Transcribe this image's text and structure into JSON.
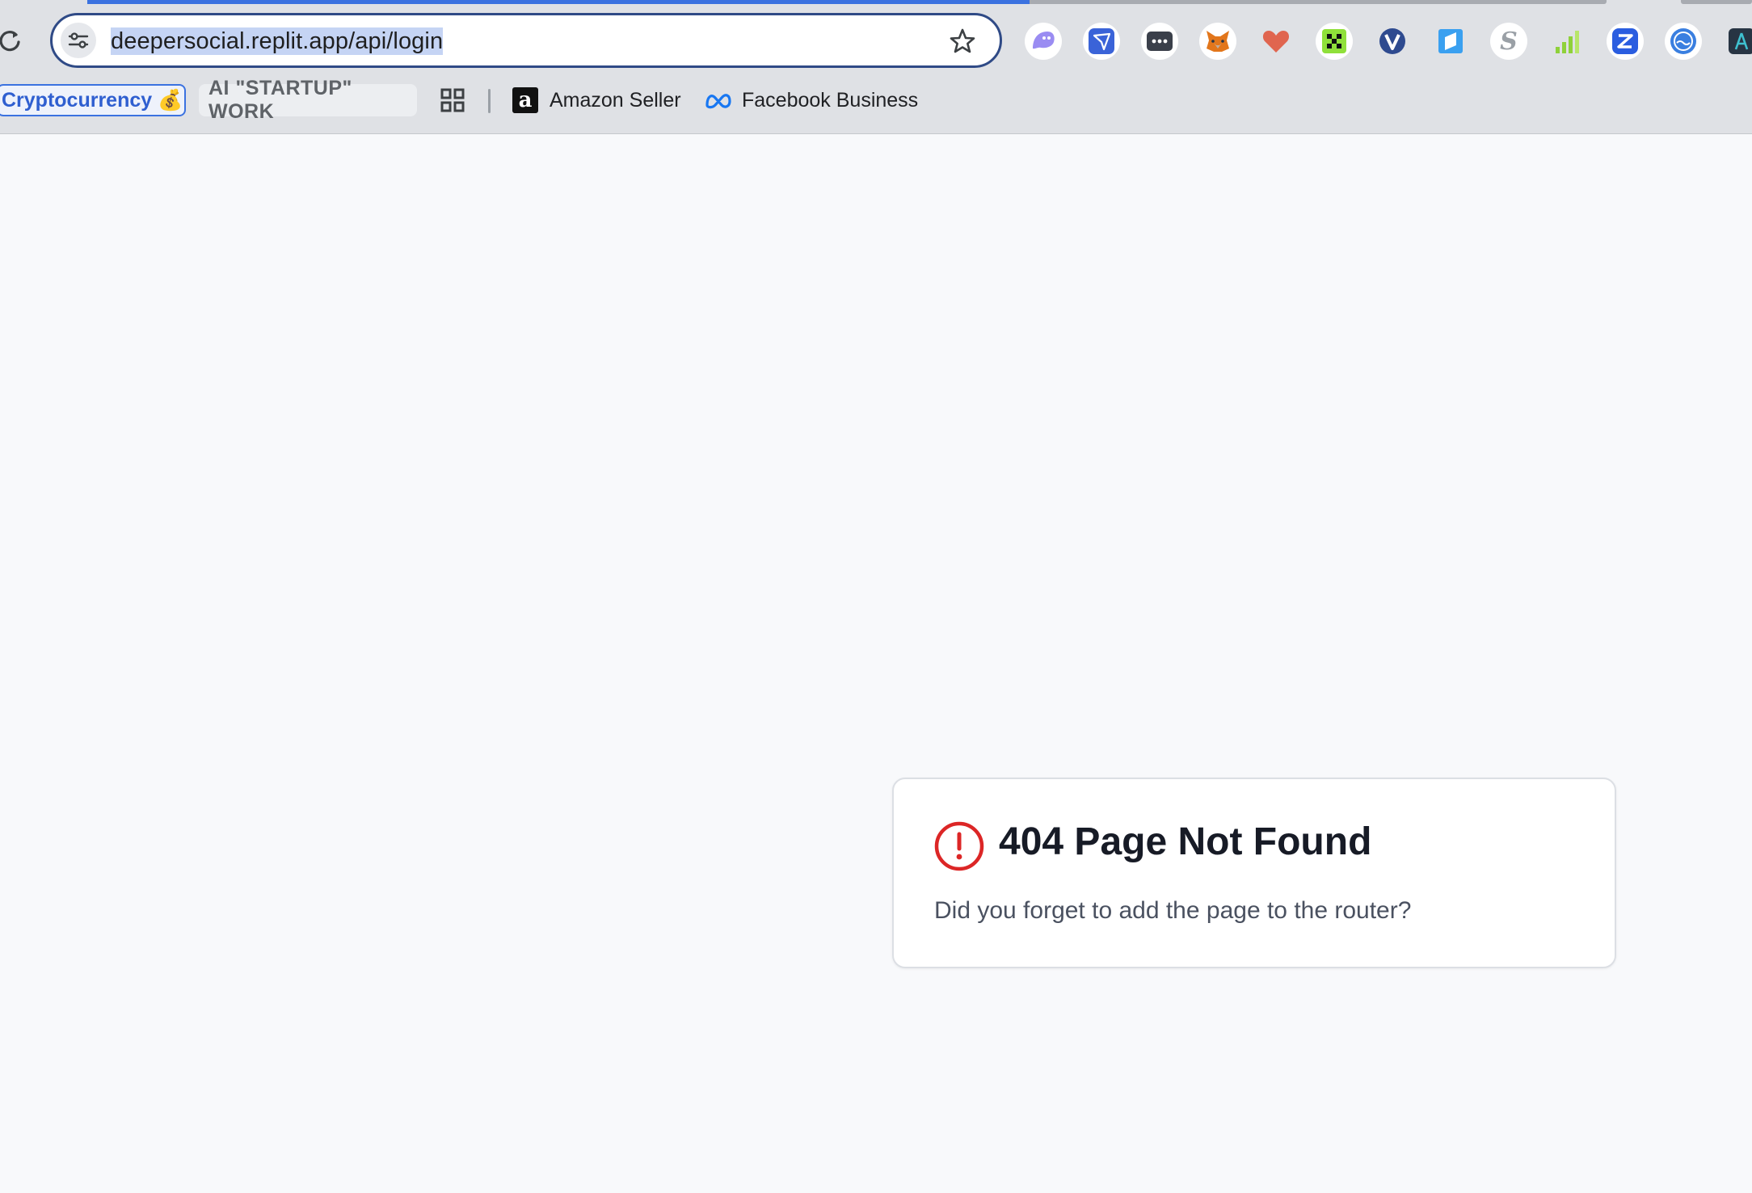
{
  "browser": {
    "url_selected": "deepersocial.replit.app/api/login",
    "reload_icon": "reload-icon",
    "site_info_icon": "tune-icon",
    "bookmark_star_icon": "star-icon",
    "loading_progress": 0.62,
    "extensions": [
      {
        "name": "ghost-extension-icon",
        "color": "#8b7cf0"
      },
      {
        "name": "paper-plane-extension-icon",
        "color": "#3a63d8"
      },
      {
        "name": "dots-extension-icon",
        "color": "#3a3f4a"
      },
      {
        "name": "metamask-fox-icon",
        "color": "#e2761b"
      },
      {
        "name": "heart-extension-icon",
        "color": "#e0654f"
      },
      {
        "name": "green-grid-extension-icon",
        "color": "#7fd12e"
      },
      {
        "name": "v-extension-icon",
        "color": "#2e4a8f"
      },
      {
        "name": "blue-square-extension-icon",
        "color": "#3aa0f0"
      },
      {
        "name": "s-extension-icon",
        "color": "#9aa0a6"
      },
      {
        "name": "signal-bars-extension-icon",
        "color": "#8fd13a"
      },
      {
        "name": "blue-z-extension-icon",
        "color": "#2a5de0"
      },
      {
        "name": "waves-extension-icon",
        "color": "#3a7fe0"
      },
      {
        "name": "compass-extension-icon",
        "color": "#2a9fb0"
      }
    ]
  },
  "bookmarks": {
    "crypto": "Cryptocurrency 💰",
    "ai": "AI \"STARTUP\" WORK",
    "apps_icon": "apps-grid-icon",
    "amazon": "Amazon Seller",
    "amazon_icon": "amazon-logo-icon",
    "facebook": "Facebook Business",
    "facebook_icon": "meta-logo-icon"
  },
  "error_card": {
    "icon": "alert-circle-icon",
    "title": "404 Page Not Found",
    "message": "Did you forget to add the page to the router?",
    "accent": "#dc2626"
  }
}
